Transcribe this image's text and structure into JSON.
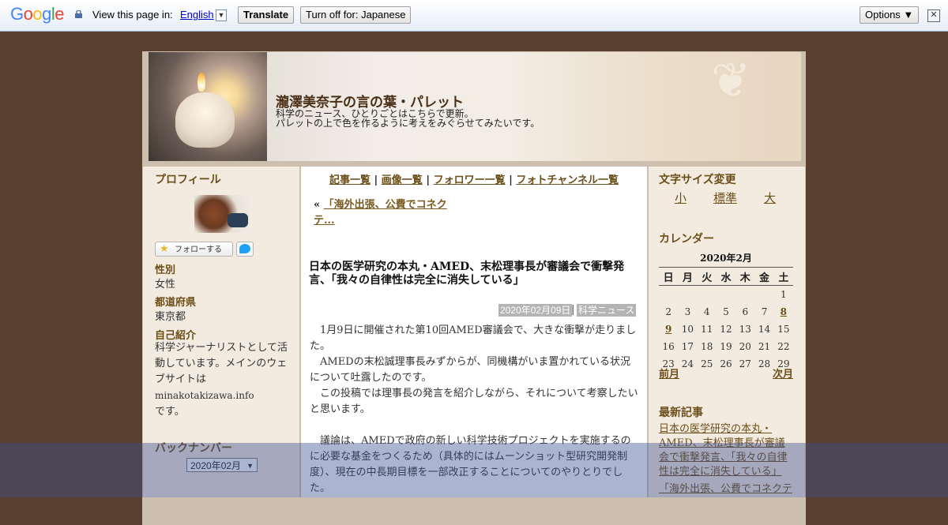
{
  "translate_bar": {
    "logo": [
      "G",
      "o",
      "o",
      "g",
      "l",
      "e"
    ],
    "logo_colors": [
      "#4285f4",
      "#ea4335",
      "#fbbc05",
      "#4285f4",
      "#34a853",
      "#ea4335"
    ],
    "prompt": "View this page in:",
    "language": "English",
    "translate_button": "Translate",
    "turn_off_button": "Turn off for: Japanese",
    "options_button": "Options ▼",
    "close_glyph": "✕"
  },
  "header": {
    "title": "瀧澤美奈子の言の葉・パレット",
    "desc_line1": "科学のニュース、ひとりごとはこちらで更新。",
    "desc_line2": "パレットの上で色を作るように考えをみぐらせてみたいです。"
  },
  "left": {
    "profile_heading": "プロフィール",
    "follow_label": "フォローする",
    "gender_label": "性別",
    "gender_value": "女性",
    "pref_label": "都道府県",
    "pref_value": "東京都",
    "intro_label": "自己紹介",
    "intro_text": "科学ジャーナリストとして活動しています。メインのウェブサイトは",
    "intro_url": "minakotakizawa.info",
    "intro_end": "です。",
    "backnumber_heading": "バックナンバー",
    "backnumber_selected": "2020年02月"
  },
  "center": {
    "nav": [
      "記事一覧",
      "画像一覧",
      "フォロワー一覧",
      "フォトチャンネル一覧"
    ],
    "prev_prefix": "«",
    "prev_link": "「海外出張、公費でコネクテ...",
    "article_title": "日本の医学研究の本丸・AMED、末松理事長が審議会で衝撃発言、「我々の自律性は完全に消失している」",
    "date": "2020年02月09日",
    "category": "科学ニュース",
    "paragraphs": [
      "　1月9日に開催された第10回AMED審議会で、大きな衝撃が走りました。",
      "　AMEDの末松誠理事長みずからが、同機構がいま置かれている状況について吐露したのです。",
      "　この投稿では理事長の発言を紹介しながら、それについて考察したいと思います。",
      "",
      "　議論は、AMEDで政府の新しい科学技術プロジェクトを実施するのに必要な基金をつくるため（具体的にはムーンショット型研究開発制度）、現在の中長期目標を一部改正することについてのやりとりでした。"
    ]
  },
  "right": {
    "font_size_heading": "文字サイズ変更",
    "font_sizes": [
      "小",
      "標準",
      "大"
    ],
    "calendar_heading": "カレンダー",
    "calendar_month": "2020年2月",
    "weekdays": [
      "日",
      "月",
      "火",
      "水",
      "木",
      "金",
      "土"
    ],
    "weeks": [
      [
        "",
        "",
        "",
        "",
        "",
        "",
        "1"
      ],
      [
        "2",
        "3",
        "4",
        "5",
        "6",
        "7",
        "8"
      ],
      [
        "9",
        "10",
        "11",
        "12",
        "13",
        "14",
        "15"
      ],
      [
        "16",
        "17",
        "18",
        "19",
        "20",
        "21",
        "22"
      ],
      [
        "23",
        "24",
        "25",
        "26",
        "27",
        "28",
        "29"
      ]
    ],
    "linked_days": [
      "8",
      "9"
    ],
    "prev_month": "前月",
    "next_month": "次月",
    "recent_heading": "最新記事",
    "recent_1": "日本の医学研究の本丸・AMED、末松理事長が審議会で衝撃発言、「我々の自律性は完全に消失している」",
    "recent_2": "「海外出張、公費でコネクテ"
  }
}
